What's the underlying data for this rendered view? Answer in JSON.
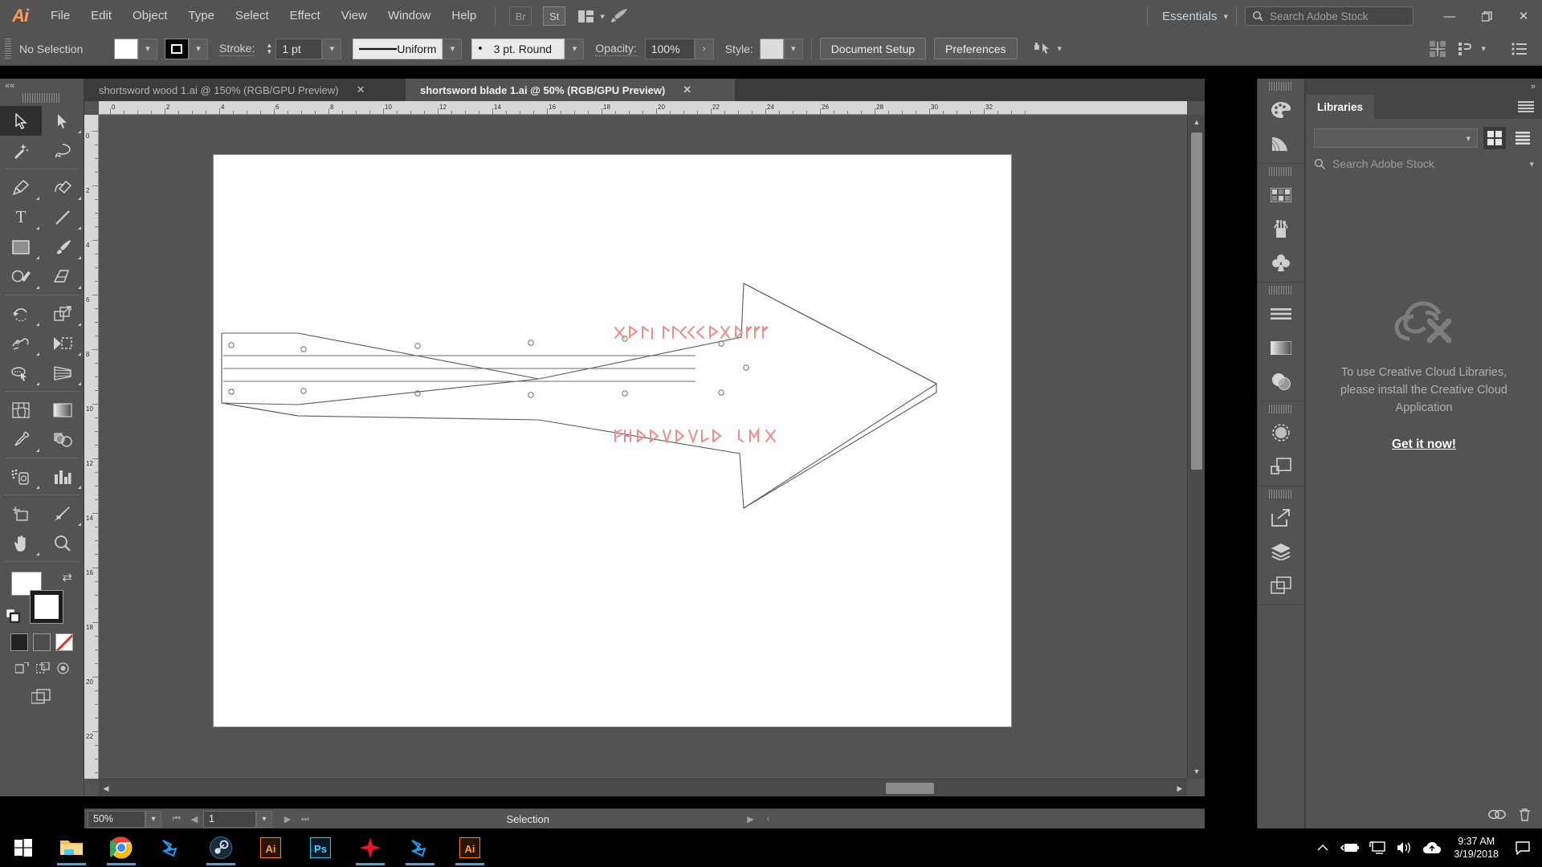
{
  "app": {
    "name": "Adobe Illustrator",
    "logo_text": "Ai"
  },
  "menubar": {
    "items": [
      "File",
      "Edit",
      "Object",
      "Type",
      "Select",
      "Effect",
      "View",
      "Window",
      "Help"
    ],
    "bridge_label": "Br",
    "stock_label": "St",
    "workspace": "Essentials",
    "search_placeholder": "Search Adobe Stock",
    "window_buttons": {
      "minimize": "—",
      "restore": "❐",
      "close": "✕"
    }
  },
  "controlbar": {
    "selection_status": "No Selection",
    "fill_color": "#ffffff",
    "stroke_color": "#000000",
    "stroke_label": "Stroke:",
    "stroke_weight": "1 pt",
    "profile_label": "Uniform",
    "brush_label": "3 pt. Round",
    "opacity_label": "Opacity:",
    "opacity_value": "100%",
    "style_label": "Style:",
    "style_swatch": "#dcdcdc",
    "document_setup_label": "Document Setup",
    "preferences_label": "Preferences"
  },
  "toolbar": {
    "tools": [
      {
        "name": "selection-tool",
        "glyph": "selection",
        "active": true,
        "corner": false
      },
      {
        "name": "direct-selection-tool",
        "glyph": "direct",
        "active": false,
        "corner": true
      },
      {
        "name": "magic-wand-tool",
        "glyph": "wand",
        "active": false,
        "corner": false
      },
      {
        "name": "lasso-tool",
        "glyph": "lasso",
        "active": false,
        "corner": false
      },
      {
        "name": "pen-tool",
        "glyph": "pen",
        "active": false,
        "corner": true
      },
      {
        "name": "curvature-tool",
        "glyph": "curvature",
        "active": false,
        "corner": true
      },
      {
        "name": "type-tool",
        "glyph": "type",
        "active": false,
        "corner": true
      },
      {
        "name": "line-segment-tool",
        "glyph": "line",
        "active": false,
        "corner": true
      },
      {
        "name": "rectangle-tool",
        "glyph": "rect",
        "active": false,
        "corner": true
      },
      {
        "name": "paintbrush-tool",
        "glyph": "brush",
        "active": false,
        "corner": true
      },
      {
        "name": "shaper-tool",
        "glyph": "shaper",
        "active": false,
        "corner": true
      },
      {
        "name": "eraser-tool",
        "glyph": "eraser",
        "active": false,
        "corner": true
      },
      {
        "name": "rotate-tool",
        "glyph": "rotate",
        "active": false,
        "corner": true
      },
      {
        "name": "scale-tool",
        "glyph": "scale",
        "active": false,
        "corner": true
      },
      {
        "name": "width-tool",
        "glyph": "width",
        "active": false,
        "corner": true
      },
      {
        "name": "free-transform-tool",
        "glyph": "freetransform",
        "active": false,
        "corner": false
      },
      {
        "name": "shape-builder-tool",
        "glyph": "shapebuilder",
        "active": false,
        "corner": true
      },
      {
        "name": "perspective-grid-tool",
        "glyph": "perspective",
        "active": false,
        "corner": true
      },
      {
        "name": "mesh-tool",
        "glyph": "mesh",
        "active": false,
        "corner": false
      },
      {
        "name": "gradient-tool",
        "glyph": "gradient",
        "active": false,
        "corner": false
      },
      {
        "name": "eyedropper-tool",
        "glyph": "eyedropper",
        "active": false,
        "corner": true
      },
      {
        "name": "blend-tool",
        "glyph": "blend",
        "active": false,
        "corner": false
      },
      {
        "name": "symbol-sprayer-tool",
        "glyph": "symbolsprayer",
        "active": false,
        "corner": true
      },
      {
        "name": "column-graph-tool",
        "glyph": "graph",
        "active": false,
        "corner": true
      },
      {
        "name": "artboard-tool",
        "glyph": "artboard",
        "active": false,
        "corner": false
      },
      {
        "name": "slice-tool",
        "glyph": "slice",
        "active": false,
        "corner": true
      },
      {
        "name": "hand-tool",
        "glyph": "hand",
        "active": false,
        "corner": true
      },
      {
        "name": "zoom-tool",
        "glyph": "zoom",
        "active": false,
        "corner": false
      }
    ]
  },
  "tabs": [
    {
      "label": "shortsword wood 1.ai @ 150% (RGB/GPU Preview)",
      "active": false,
      "close": "✕"
    },
    {
      "label": "shortsword blade 1.ai @ 50% (RGB/GPU Preview)",
      "active": true,
      "close": "✕"
    }
  ],
  "rulers": {
    "horizontal_ticks": [
      "0",
      "2",
      "4",
      "6",
      "8",
      "10",
      "12",
      "14",
      "16",
      "18",
      "20",
      "22",
      "24",
      "26",
      "28",
      "30",
      "32"
    ],
    "vertical_ticks": [
      "0",
      "2",
      "4",
      "6",
      "8",
      "10",
      "12",
      "14",
      "16",
      "18",
      "20",
      "22"
    ]
  },
  "artwork": {
    "title": "shortsword blade outline",
    "rune_text_top": "rune inscription upper",
    "rune_text_bottom": "rune inscription lower",
    "rune_color": "#f08a8a",
    "outline_color": "#595959"
  },
  "statusbar": {
    "zoom_level": "50%",
    "artboard_number": "1",
    "status_text": "Selection"
  },
  "dock": {
    "groups": [
      [
        "color-panel-icon",
        "color-guide-panel-icon"
      ],
      [
        "swatches-panel-icon",
        "brushes-panel-icon",
        "symbols-panel-icon"
      ],
      [
        "stroke-panel-icon",
        "gradient-panel-icon",
        "transparency-panel-icon"
      ],
      [
        "appearance-panel-icon",
        "graphic-styles-panel-icon"
      ],
      [
        "export-panel-icon",
        "layers-panel-icon",
        "artboards-panel-icon"
      ]
    ]
  },
  "libraries_panel": {
    "tab_label": "Libraries",
    "collapse_glyph": "»",
    "library_select_value": "",
    "search_placeholder": "Search Adobe Stock",
    "empty_message_line1": "To use Creative Cloud Libraries,",
    "empty_message_line2": "please install the Creative Cloud",
    "empty_message_line3": "Application",
    "cta_label": "Get it now!"
  },
  "taskbar": {
    "apps": [
      {
        "name": "file-explorer-icon",
        "running": true
      },
      {
        "name": "google-chrome-icon",
        "running": true
      },
      {
        "name": "blender-icon",
        "running": false
      },
      {
        "name": "steam-icon",
        "running": true
      },
      {
        "name": "illustrator-icon",
        "running": false
      },
      {
        "name": "photoshop-icon",
        "running": false
      },
      {
        "name": "substance-icon",
        "running": true
      },
      {
        "name": "blender-icon-2",
        "running": true
      },
      {
        "name": "illustrator-icon-2",
        "running": true
      }
    ],
    "tray_icons": [
      "show-hidden-icons",
      "battery-icon",
      "display-icon",
      "volume-icon",
      "onedrive-icon"
    ],
    "time": "9:37 AM",
    "date": "3/19/2018"
  }
}
